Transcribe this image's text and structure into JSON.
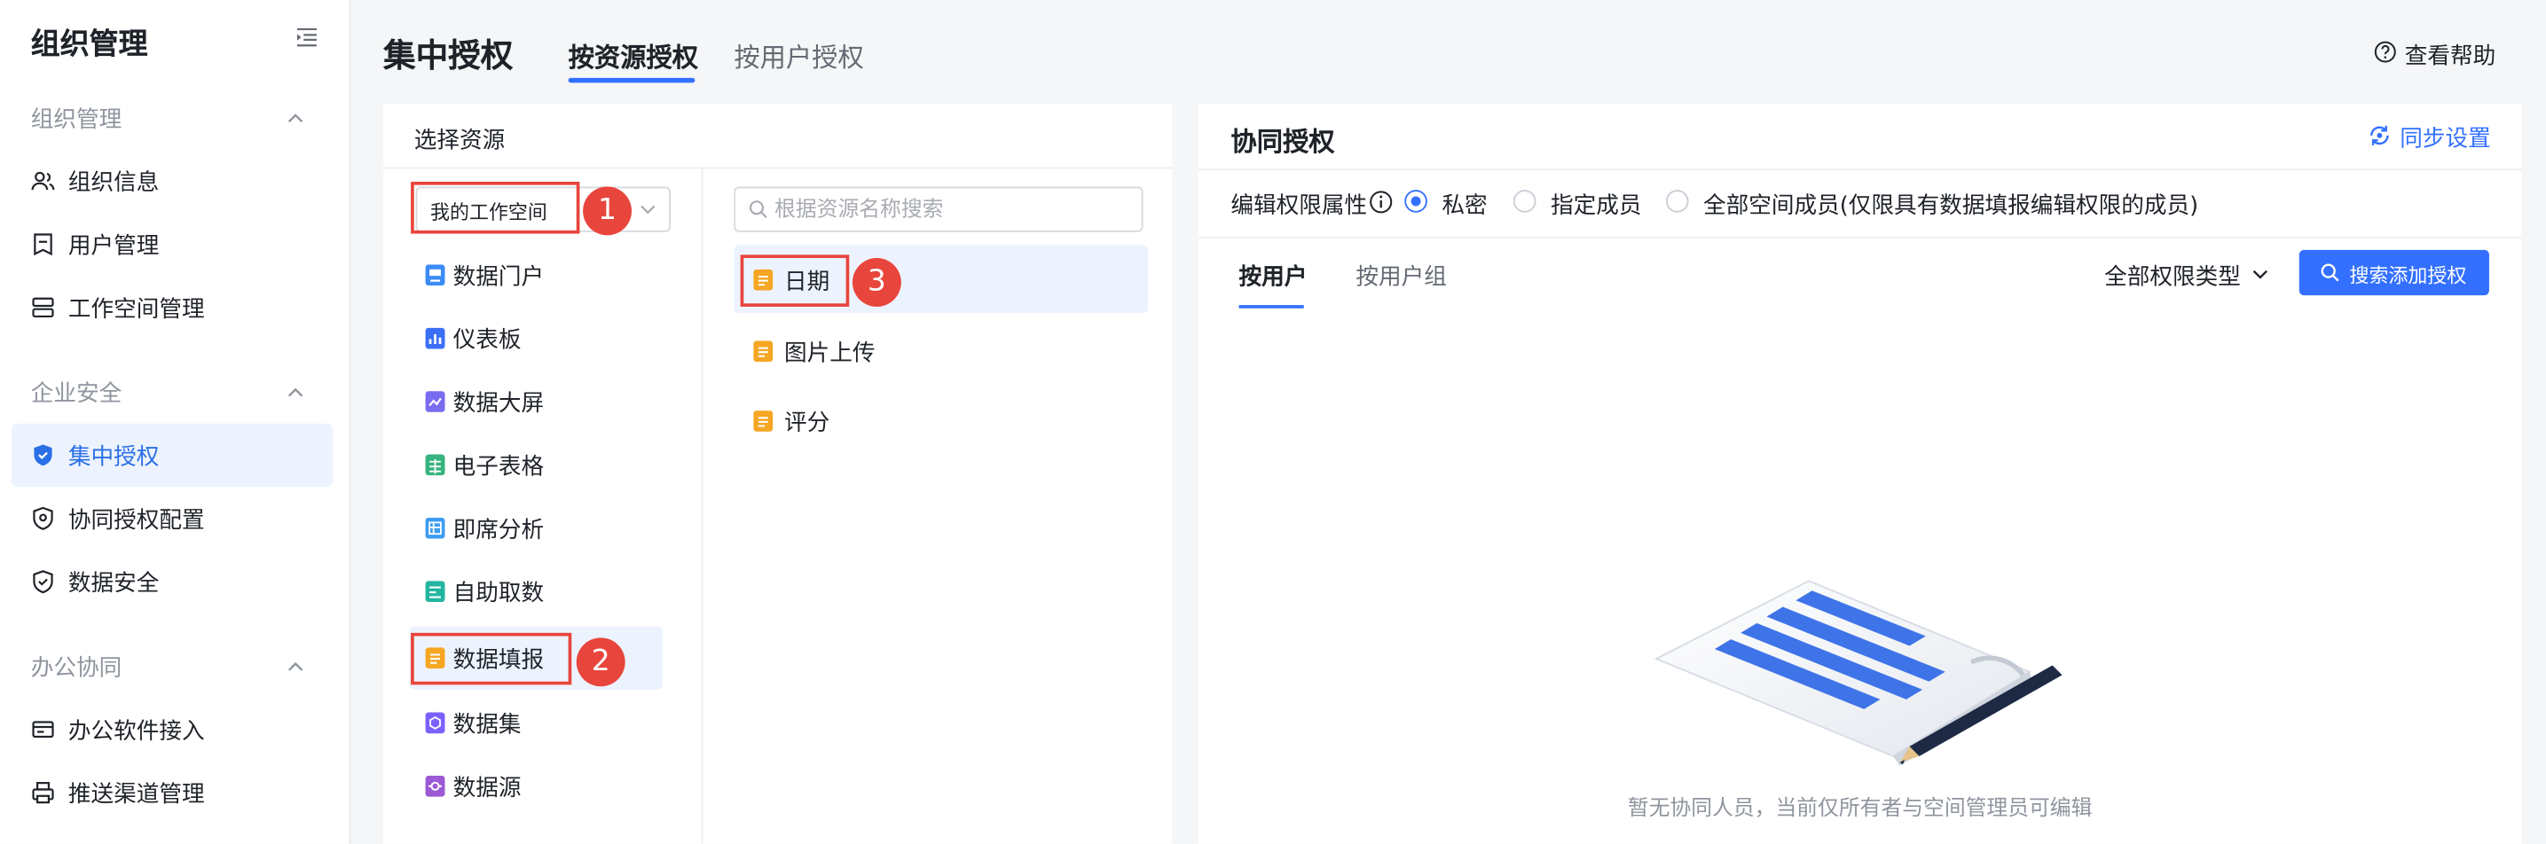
{
  "sidebar": {
    "title": "组织管理",
    "sections": [
      {
        "label": "组织管理",
        "items": [
          {
            "label": "组织信息",
            "icon": "users-icon"
          },
          {
            "label": "用户管理",
            "icon": "user-card-icon"
          },
          {
            "label": "工作空间管理",
            "icon": "server-icon"
          }
        ]
      },
      {
        "label": "企业安全",
        "items": [
          {
            "label": "集中授权",
            "icon": "shield-check-icon",
            "active": true
          },
          {
            "label": "协同授权配置",
            "icon": "shield-cog-icon"
          },
          {
            "label": "数据安全",
            "icon": "shield-ok-icon"
          }
        ]
      },
      {
        "label": "办公协同",
        "items": [
          {
            "label": "办公软件接入",
            "icon": "plug-icon"
          },
          {
            "label": "推送渠道管理",
            "icon": "printer-icon"
          }
        ]
      }
    ]
  },
  "header": {
    "title": "集中授权",
    "tabs": [
      "按资源授权",
      "按用户授权"
    ],
    "active_tab": 0,
    "help_label": "查看帮助"
  },
  "resource_panel": {
    "title": "选择资源",
    "workspace_select": "我的工作空间",
    "search_placeholder": "根据资源名称搜索",
    "resource_types": [
      {
        "label": "数据门户",
        "color": "#3b8cf5"
      },
      {
        "label": "仪表板",
        "color": "#3b6ff5"
      },
      {
        "label": "数据大屏",
        "color": "#7a6cf0"
      },
      {
        "label": "电子表格",
        "color": "#36b37e"
      },
      {
        "label": "即席分析",
        "color": "#3d9cf2"
      },
      {
        "label": "自助取数",
        "color": "#23b5a0"
      },
      {
        "label": "数据填报",
        "color": "#f5a623",
        "active": true
      },
      {
        "label": "数据集",
        "color": "#7b61ff"
      },
      {
        "label": "数据源",
        "color": "#9b59d6"
      }
    ],
    "forms": [
      {
        "label": "日期",
        "active": true
      },
      {
        "label": "图片上传"
      },
      {
        "label": "评分"
      }
    ],
    "badges": [
      "1",
      "2",
      "3"
    ]
  },
  "collab_panel": {
    "title": "协同授权",
    "sync_label": "同步设置",
    "perm_attr_label": "编辑权限属性",
    "radio_options": [
      {
        "label": "私密",
        "checked": true
      },
      {
        "label": "指定成员",
        "checked": false
      },
      {
        "label": "全部空间成员(仅限具有数据填报编辑权限的成员)",
        "checked": false
      }
    ],
    "sub_tabs": [
      "按用户",
      "按用户组"
    ],
    "perm_type_label": "全部权限类型",
    "add_button_label": "搜索添加授权",
    "empty_text": "暂无协同人员，当前仅所有者与空间管理员可编辑"
  },
  "colors": {
    "accent": "#3370ff",
    "annotation": "#e8453c",
    "active_bg": "#edf3fe"
  }
}
